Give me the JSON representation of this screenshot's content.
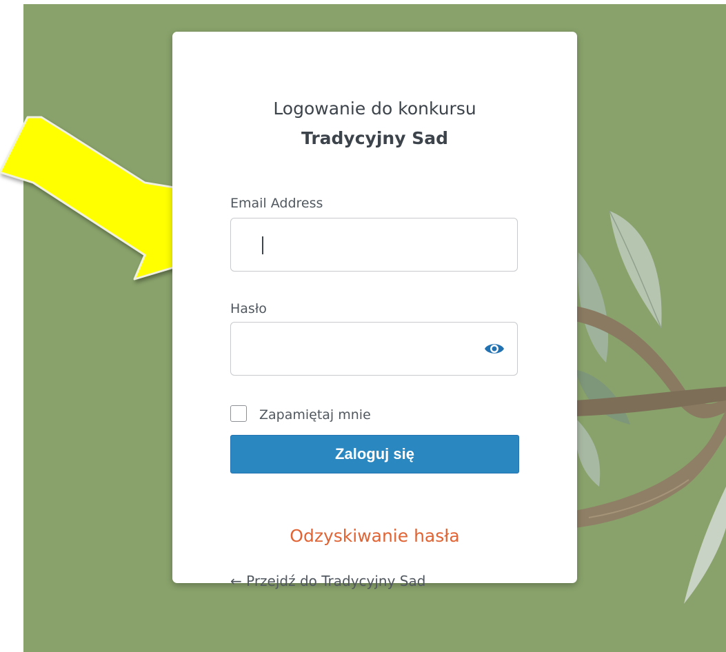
{
  "login": {
    "title_line1": "Logowanie do konkursu",
    "title_line2": "Tradycyjny Sad",
    "email_label": "Email Address",
    "email_value": "",
    "password_label": "Hasło",
    "password_value": "",
    "remember_label": "Zapamiętaj mnie",
    "remember_checked": false,
    "submit_label": "Zaloguj się",
    "recover_link": "Odzyskiwanie hasła",
    "back_link": "← Przejdź do Tradycyjny Sad"
  },
  "icons": {
    "password_toggle": "eye-icon",
    "callout": "arrow-icon"
  },
  "colors": {
    "background": "#89a26b",
    "button": "#2a87c0",
    "recover_link": "#e06434",
    "arrow": "#ffff00"
  }
}
